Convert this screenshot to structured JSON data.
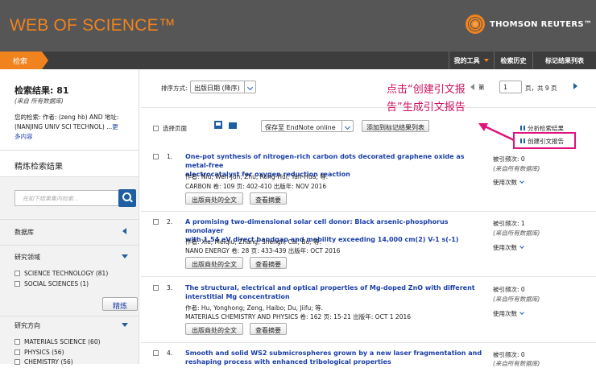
{
  "header": {
    "logo": "WEB OF SCIENCE™",
    "publisher": "THOMSON REUTERS™"
  },
  "nav": {
    "search_tab": "检索",
    "my_tools": "我的工具",
    "history": "检索历史",
    "marked": "标记结果列表"
  },
  "sidebar": {
    "results_label": "检索结果: 81",
    "results_source": "(来自 所有数据库)",
    "query_line1": "您的检索: 作者: (zeng hb) AND 地址:",
    "query_line2": "(NANJING UNIV SCI TECHNOL) ...",
    "query_more": "更",
    "query_more2": "多内容",
    "refine_title": "精炼检索结果",
    "search_placeholder": "在如下结果集内检索...",
    "database_label": "数据库",
    "research_area_label": "研究领域",
    "areas": [
      "SCIENCE TECHNOLOGY (81)",
      "SOCIAL SCIENCES (1)"
    ],
    "refine_button": "精炼",
    "direction_label": "研究方向",
    "directions": [
      "MATERIALS SCIENCE (60)",
      "PHYSICS (56)",
      "CHEMISTRY (56)"
    ]
  },
  "toolbar": {
    "sort_label": "排序方式:",
    "sort_value": "出版日期 (降序)",
    "page_label": "第",
    "page_value": "1",
    "page_total": "页，共 9 页",
    "select_page": "选择页面",
    "save_to": "保存至 EndNote online",
    "add_marked": "添加到标记结果列表",
    "analyze": "分析检索结果",
    "citation_report": "创建引文报告"
  },
  "annotation": {
    "line1": "点击“创建引文报",
    "line2": "告”生成引文报告"
  },
  "results": [
    {
      "num": "1.",
      "title1": "One-pot synthesis of nitrogen-rich carbon dots decorated graphene oxide as metal-free",
      "title2": "electrocatalyst for oxygen reduction reaction",
      "authors": "作者: Niu, Wen-Jun; Zhu, Rong-Hui; Yan-Hua; 等.",
      "source": "CARBON  卷: 109  页: 402-410  出版年: NOV 2016",
      "btn1": "出版商处的全文",
      "btn2": "查看摘要",
      "cited": "被引频次: 0",
      "cited_src": "(来自所有数据库)",
      "usage": "使用次数"
    },
    {
      "num": "2.",
      "title1": "A promising two-dimensional solar cell donor: Black arsenic-phosphorus monolayer",
      "title2": "with 1.54 eV direct bandgap and mobility exceeding 14,000 cm(2) V-1 s(-1)",
      "authors": "作者: Xie, Meiqiu; Zhang, Shengli; Cai, Bo; 等.",
      "source": "NANO ENERGY  卷: 28  页: 433-439  出版年: OCT 2016",
      "btn1": "出版商处的全文",
      "btn2": "查看摘要",
      "cited": "被引频次: 1",
      "cited_src": "(来自所有数据库)",
      "usage": "使用次数"
    },
    {
      "num": "3.",
      "title1": "The structural, electrical and optical properties of Mg-doped ZnO with different",
      "title2": "interstitial Mg concentration",
      "authors": "作者: Hu, Yonghong; Zeng, Haibo; Du, Jiifu; 等.",
      "source": "MATERIALS CHEMISTRY AND PHYSICS  卷: 162  页: 15-21  出版年: OCT 1 2016",
      "btn1": "出版商处的全文",
      "btn2": "查看摘要",
      "cited": "被引频次: 0",
      "cited_src": "(来自所有数据库)",
      "usage": "使用次数"
    },
    {
      "num": "4.",
      "title1": "Smooth and solid WS2 submicrospheres grown by a new laser fragmentation and",
      "title2": "reshaping process with enhanced tribological properties",
      "cited": "被引频次: 0",
      "cited_src": "(来自所有数据库)"
    }
  ]
}
